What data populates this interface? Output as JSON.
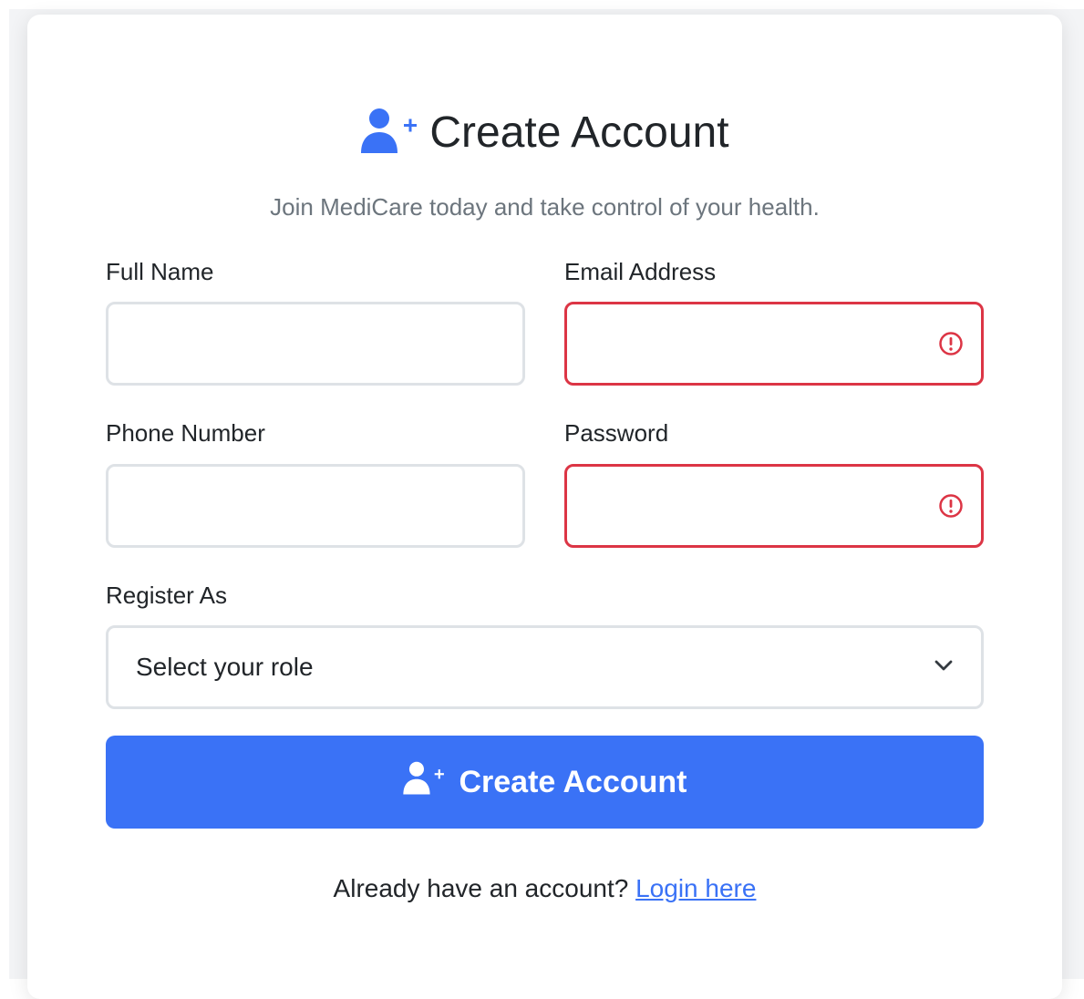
{
  "header": {
    "title": "Create Account",
    "icon": "user-plus-icon",
    "subtitle": "Join MediCare today and take control of your health."
  },
  "form": {
    "full_name": {
      "label": "Full Name",
      "value": "",
      "placeholder": ""
    },
    "email": {
      "label": "Email Address",
      "value": "",
      "placeholder": "",
      "status": "invalid"
    },
    "phone": {
      "label": "Phone Number",
      "value": "",
      "placeholder": ""
    },
    "password": {
      "label": "Password",
      "value": "",
      "placeholder": "",
      "status": "invalid"
    },
    "role": {
      "label": "Register As",
      "selected": "Select your role"
    },
    "submit_label": "Create Account"
  },
  "footer": {
    "prompt": "Already have an account?",
    "link_label": "Login here"
  },
  "colors": {
    "primary": "#3a72f6",
    "invalid": "#dc3545",
    "border": "#dee2e6",
    "text": "#212529",
    "muted": "#6c757d"
  }
}
